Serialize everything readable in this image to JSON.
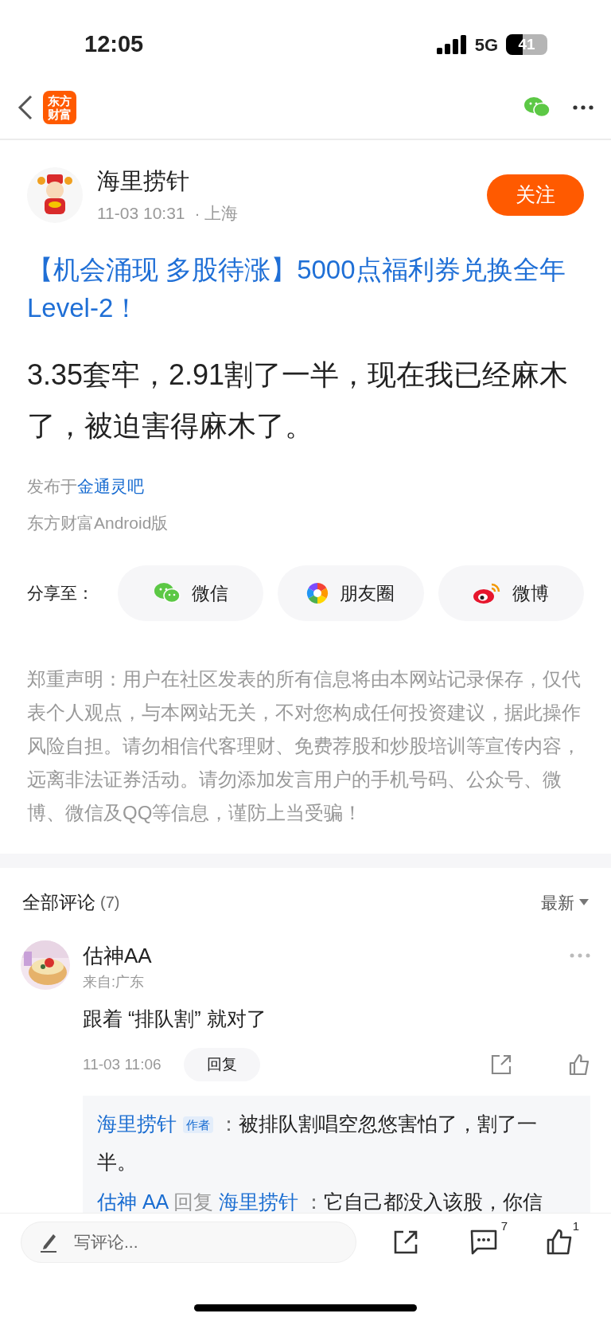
{
  "status_bar": {
    "time": "12:05",
    "network": "5G",
    "battery": "41"
  },
  "nav": {
    "logo": [
      "东方",
      "财富"
    ]
  },
  "author": {
    "name": "海里捞针",
    "time": "11-03 10:31",
    "location": "· 上海",
    "follow": "关注"
  },
  "post": {
    "title": "【机会涌现 多股待涨】5000点福利券兑换全年Level-2！",
    "body": "3.35套牢，2.91割了一半，现在我已经麻木了，被迫害得麻木了。",
    "published_prefix": "发布于",
    "forum": "金通灵吧",
    "client": "东方财富Android版"
  },
  "share": {
    "label": "分享至：",
    "targets": [
      {
        "kind": "wechat",
        "label": "微信"
      },
      {
        "kind": "moments",
        "label": "朋友圈"
      },
      {
        "kind": "weibo",
        "label": "微博"
      }
    ]
  },
  "disclaimer": "郑重声明：用户在社区发表的所有信息将由本网站记录保存，仅代表个人观点，与本网站无关，不对您构成任何投资建议，据此操作风险自担。请勿相信代客理财、免费荐股和炒股培训等宣传内容，远离非法证券活动。请勿添加发言用户的手机号码、公众号、微博、微信及QQ等信息，谨防上当受骗！",
  "comments_header": {
    "title": "全部评论",
    "count": "(7)",
    "sort": "最新"
  },
  "comments": [
    {
      "name": "估神AA",
      "from": "来自:广东",
      "text": "跟着 “排队割” 就对了",
      "time": "11-03 11:06",
      "reply": "回复",
      "replies": [
        {
          "name": "海里捞针",
          "badge": "作者",
          "separator": "：",
          "text": "被排队割唱空忽悠害怕了，割了一半。"
        },
        {
          "name": "估神 AA",
          "reply_word": "回复",
          "target": "海里捞针",
          "separator": "：",
          "text": "它自己都没入该股，你信"
        }
      ]
    }
  ],
  "bottom_bar": {
    "placeholder": "写评论...",
    "comment_count": "7",
    "like_count": "1"
  }
}
